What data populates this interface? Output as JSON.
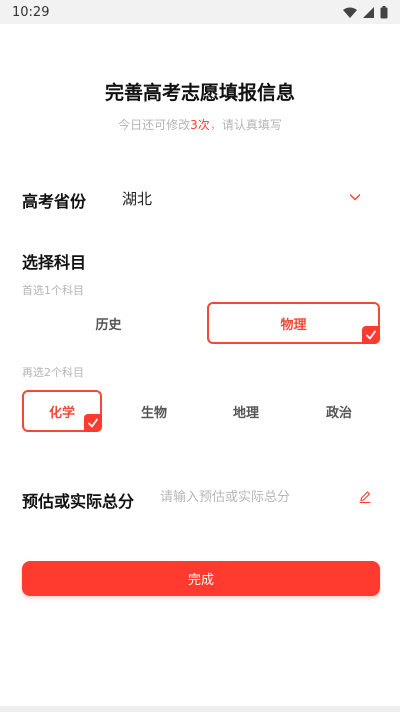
{
  "status_bar": {
    "time": "10:29"
  },
  "header": {
    "title": "完善高考志愿填报信息",
    "subtitle_prefix": "今日还可修改",
    "subtitle_count": "3次",
    "subtitle_suffix": "，请认真填写"
  },
  "province": {
    "label": "高考省份",
    "value": "湖北",
    "icon": "chevron-down-icon"
  },
  "subjects": {
    "title": "选择科目",
    "first_hint": "首选1个科目",
    "first_options": [
      {
        "label": "历史",
        "selected": false
      },
      {
        "label": "物理",
        "selected": true
      }
    ],
    "second_hint": "再选2个科目",
    "second_options": [
      {
        "label": "化学",
        "selected": true
      },
      {
        "label": "生物",
        "selected": false
      },
      {
        "label": "地理",
        "selected": false
      },
      {
        "label": "政治",
        "selected": false
      }
    ]
  },
  "score": {
    "label": "预估或实际总分",
    "value": "",
    "placeholder": "请输入预估或实际总分",
    "icon": "edit-icon"
  },
  "submit": {
    "label": "完成"
  },
  "colors": {
    "accent": "#ff3b30",
    "muted": "#b5b5b5",
    "title": "#111111"
  }
}
